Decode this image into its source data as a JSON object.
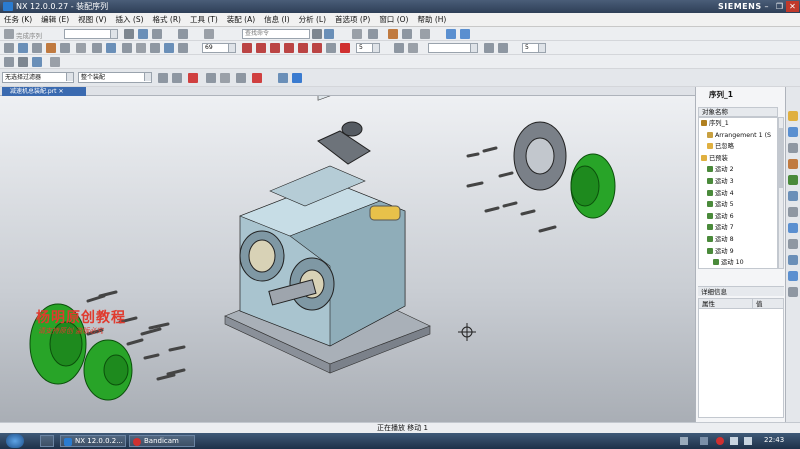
{
  "window": {
    "title": "NX 12.0.0.27 - 装配序列",
    "brand": "SIEMENS",
    "minimize": "–",
    "restore": "❐",
    "close": "✕"
  },
  "menu": [
    "任务 (K)",
    "编辑 (E)",
    "视图 (V)",
    "插入 (S)",
    "格式 (R)",
    "工具 (T)",
    "装配 (A)",
    "信息 (I)",
    "分析 (L)",
    "首选项 (P)",
    "窗口 (O)",
    "帮助 (H)"
  ],
  "toolbar": {
    "row1": {
      "complete_sequence": "完成序列",
      "search_placeholder": "查找命令"
    },
    "row2": {
      "speed_value": "69",
      "step_value": "5",
      "step_value2": "5"
    },
    "row4": {
      "filter_select": "无选择过滤器",
      "assembly_select": "整个装配"
    }
  },
  "tab": {
    "label": "减速机总装配.prt"
  },
  "watermark": {
    "line1": "杨明原创教程",
    "line2": "请支持原创  盗版必究"
  },
  "navigator": {
    "title": "序列_1",
    "column": "对象名称",
    "tree": [
      {
        "label": "序列_1",
        "indent": 0,
        "icon": "#b08020"
      },
      {
        "label": "Arrangement 1 (S",
        "indent": 1,
        "icon": "#c8a040"
      },
      {
        "label": "已忽略",
        "indent": 1,
        "icon": "#e0b040"
      },
      {
        "label": "已预装",
        "indent": 1,
        "icon": "#e0b040"
      },
      {
        "label": "运动 2",
        "indent": 2,
        "icon": "#4a8a3a"
      },
      {
        "label": "运动 3",
        "indent": 2,
        "icon": "#4a8a3a"
      },
      {
        "label": "运动 4",
        "indent": 2,
        "icon": "#4a8a3a"
      },
      {
        "label": "运动 5",
        "indent": 2,
        "icon": "#4a8a3a"
      },
      {
        "label": "运动 6",
        "indent": 2,
        "icon": "#4a8a3a"
      },
      {
        "label": "运动 7",
        "indent": 2,
        "icon": "#4a8a3a"
      },
      {
        "label": "运动 8",
        "indent": 2,
        "icon": "#4a8a3a"
      },
      {
        "label": "运动 9",
        "indent": 2,
        "icon": "#4a8a3a"
      },
      {
        "label": "运动 10",
        "indent": 3,
        "icon": "#4a8a3a"
      }
    ],
    "detail_title": "详细信息",
    "detail_col_prop": "属性",
    "detail_col_val": "值"
  },
  "status": {
    "text": "正在播放   移动  1"
  },
  "taskbar": {
    "nx_task": "NX 12.0.0.2...",
    "bandicam_task": "Bandicam",
    "clock": "22:43"
  }
}
